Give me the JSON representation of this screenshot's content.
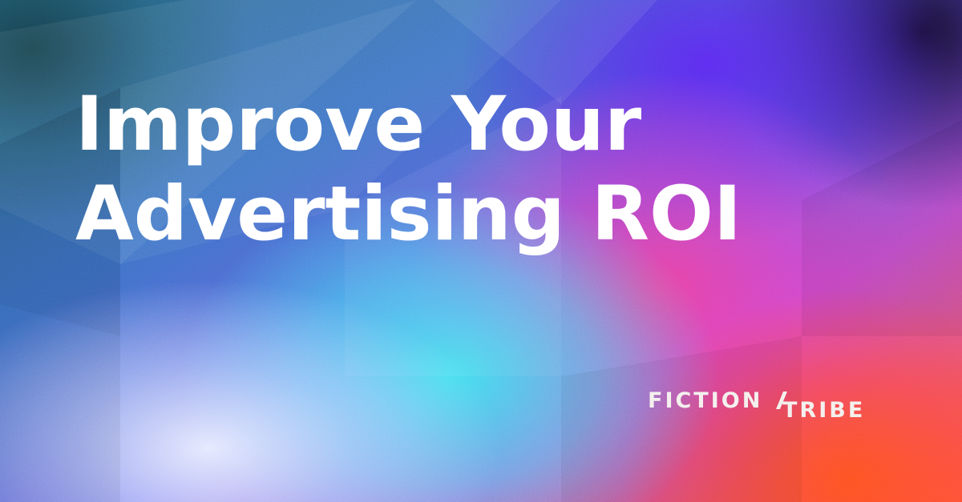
{
  "banner": {
    "headline_line1": "Improve Your",
    "headline_line2": "Advertising ROI",
    "logo_word1": "FICTION",
    "logo_word2": "TRIBE"
  },
  "colors": {
    "text": "#ffffff",
    "logo": "#f4f0ee",
    "cyan": "#3ce6f0",
    "violet": "#5a2cf0",
    "magenta": "#e83cc0",
    "orange": "#ff5a2a"
  }
}
